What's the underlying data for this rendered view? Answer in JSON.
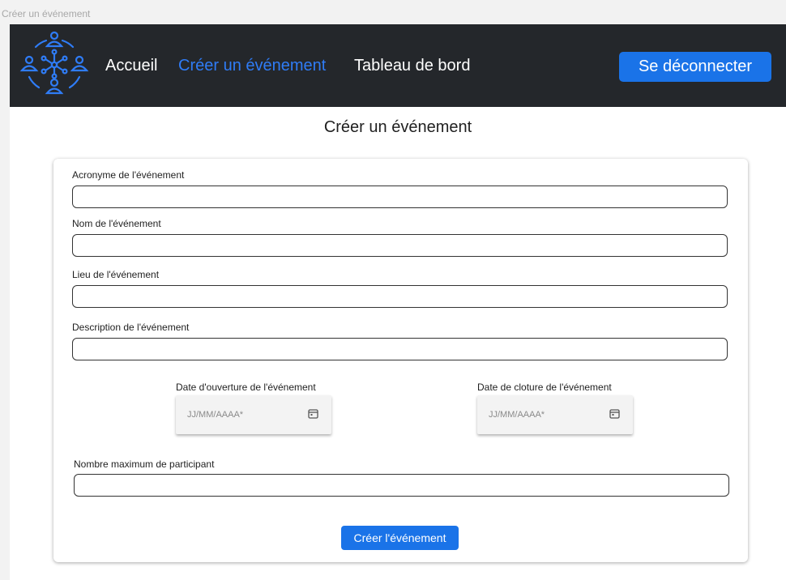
{
  "window": {
    "title": "Créer un événement"
  },
  "nav": {
    "logo_icon": "people-network-icon",
    "links": [
      {
        "label": "Accueil",
        "active": false
      },
      {
        "label": "Créer un événement",
        "active": true
      },
      {
        "label": "Tableau de bord",
        "active": false
      }
    ],
    "logout_label": "Se déconnecter"
  },
  "page": {
    "title": "Créer un événement"
  },
  "form": {
    "acronym": {
      "label": "Acronyme de l'événement",
      "value": ""
    },
    "name": {
      "label": "Nom de l'événement",
      "value": ""
    },
    "location": {
      "label": "Lieu de l'événement",
      "value": ""
    },
    "description": {
      "label": "Description de l'événement",
      "value": ""
    },
    "open_date": {
      "label": "Date d'ouverture de l'événement",
      "placeholder": "JJ/MM/AAAA*",
      "icon": "calendar-icon"
    },
    "close_date": {
      "label": "Date de cloture de l'événement",
      "placeholder": "JJ/MM/AAAA*",
      "icon": "calendar-icon"
    },
    "max_participants": {
      "label": "Nombre maximum de participant",
      "value": ""
    },
    "submit_label": "Créer l'événement"
  },
  "colors": {
    "navbar_bg": "#24272b",
    "accent": "#1a73e8",
    "active_link": "#2f7cf6"
  }
}
